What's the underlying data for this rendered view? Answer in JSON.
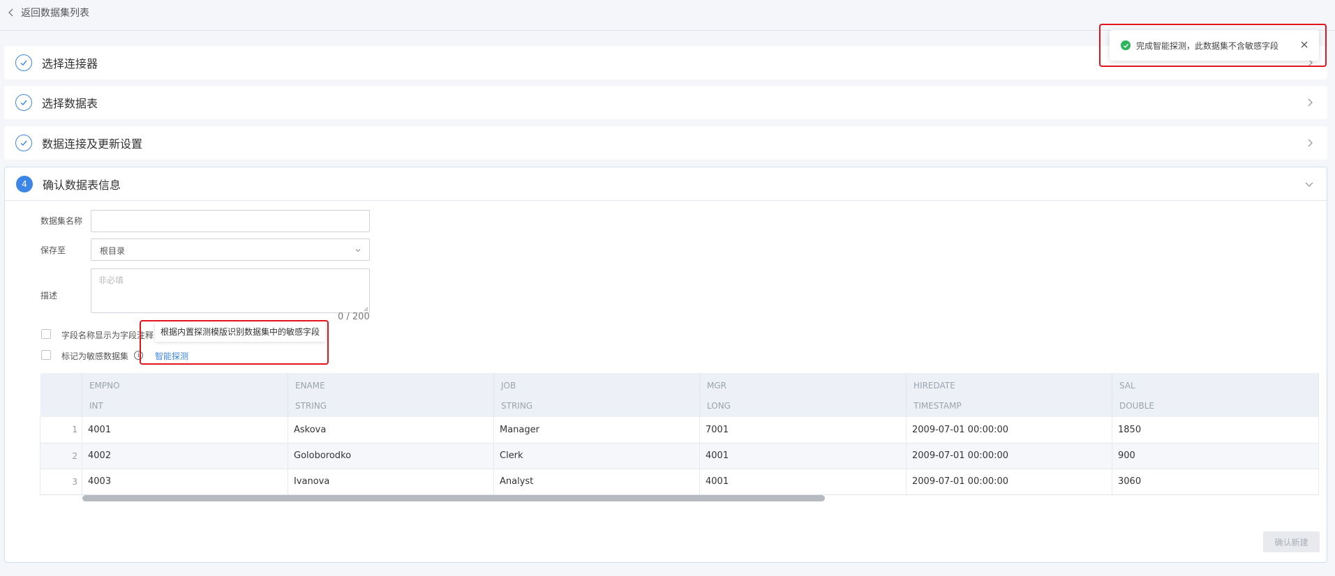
{
  "nav": {
    "back_label": "返回数据集列表"
  },
  "steps": [
    {
      "title": "选择连接器"
    },
    {
      "title": "选择数据表"
    },
    {
      "title": "数据连接及更新设置"
    },
    {
      "number": "4",
      "title": "确认数据表信息"
    }
  ],
  "form": {
    "name_label": "数据集名称",
    "name_value": "",
    "save_label": "保存至",
    "save_value": "根目录",
    "desc_label": "描述",
    "desc_placeholder": "非必填",
    "desc_counter": "0 / 200",
    "checkbox_field_comment": "字段名称显示为字段注释",
    "checkbox_sensitive": "标记为敏感数据集",
    "detect_link": "智能探测",
    "tooltip": "根据内置探测模版识别数据集中的敏感字段"
  },
  "table": {
    "columns": [
      {
        "name": "EMPNO",
        "type": "INT"
      },
      {
        "name": "ENAME",
        "type": "STRING"
      },
      {
        "name": "JOB",
        "type": "STRING"
      },
      {
        "name": "MGR",
        "type": "LONG"
      },
      {
        "name": "HIREDATE",
        "type": "TIMESTAMP"
      },
      {
        "name": "SAL",
        "type": "DOUBLE"
      }
    ],
    "rows": [
      [
        "1",
        "4001",
        "Askova",
        "Manager",
        "7001",
        "2009-07-01 00:00:00",
        "1850"
      ],
      [
        "2",
        "4002",
        "Goloborodko",
        "Clerk",
        "4001",
        "2009-07-01 00:00:00",
        "900"
      ],
      [
        "3",
        "4003",
        "Ivanova",
        "Analyst",
        "4001",
        "2009-07-01 00:00:00",
        "3060"
      ]
    ]
  },
  "actions": {
    "confirm_label": "确认新建"
  },
  "toast": {
    "message": "完成智能探测，此数据集不含敏感字段"
  },
  "colors": {
    "accent": "#3b86e6",
    "success": "#2db55d",
    "highlight": "#e3141c"
  }
}
